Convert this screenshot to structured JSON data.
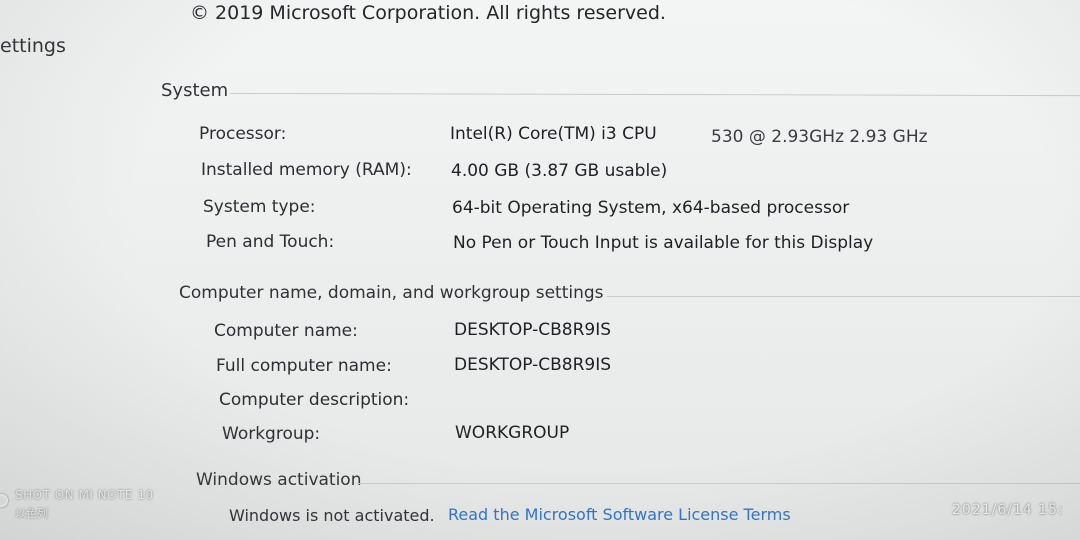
{
  "header": {
    "copyright": "© 2019 Microsoft Corporation. All rights reserved.",
    "settings_link": "ettings"
  },
  "system": {
    "title": "System",
    "rows": [
      {
        "label": "Processor:",
        "value": "Intel(R) Core(TM) i3 CPU",
        "value_extra": "530  @ 2.93GHz  2.93 GHz"
      },
      {
        "label": "Installed memory (RAM):",
        "value": "4.00 GB (3.87 GB usable)"
      },
      {
        "label": "System type:",
        "value": "64-bit Operating System, x64-based processor"
      },
      {
        "label": "Pen and Touch:",
        "value": "No Pen or Touch Input is available for this Display"
      }
    ]
  },
  "computer": {
    "title": "Computer name, domain, and workgroup settings",
    "rows": [
      {
        "label": "Computer name:",
        "value": "DESKTOP-CB8R9IS"
      },
      {
        "label": "Full computer name:",
        "value": "DESKTOP-CB8R9IS"
      },
      {
        "label": "Computer description:",
        "value": ""
      },
      {
        "label": "Workgroup:",
        "value": "WORKGROUP"
      }
    ]
  },
  "activation": {
    "title": "Windows activation",
    "status": "Windows is not activated.",
    "license_link": "Read the Microsoft Software License Terms"
  },
  "photo_watermark": {
    "device": "SHOT ON MI NOTE 10",
    "subtitle": "以色列",
    "timestamp": "2021/6/14  15:"
  },
  "colors": {
    "link": "#2e73c9",
    "background": "#eceeee"
  }
}
